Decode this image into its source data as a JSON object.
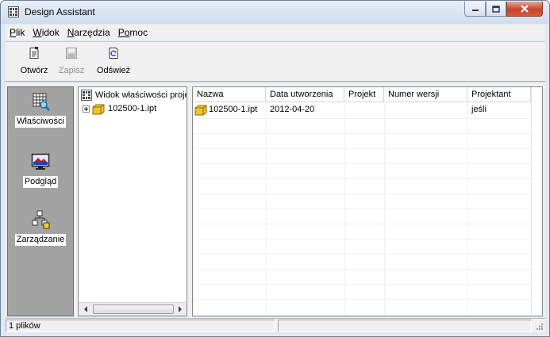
{
  "window": {
    "title": "Design Assistant",
    "app_icon": "design-assistant-icon"
  },
  "menu": [
    {
      "label_u": "P",
      "label_rest": "lik"
    },
    {
      "label_u": "W",
      "label_rest": "idok"
    },
    {
      "label_u": "N",
      "label_rest": "arzędzia"
    },
    {
      "label_u": "Po",
      "label_rest": "moc"
    }
  ],
  "toolbar": {
    "open_label": "Otwórz",
    "save_label": "Zapisz",
    "refresh_label": "Odśwież"
  },
  "leftbar": {
    "properties_label": "Właściwości",
    "preview_label": "Podgląd",
    "manage_label": "Zarządzanie"
  },
  "tree": {
    "root_label": "Widok właściwości proje",
    "node_label": "102500-1.ipt"
  },
  "list": {
    "columns": [
      "Nazwa",
      "Data utworzenia",
      "Projekt",
      "Numer wersji",
      "Projektant"
    ],
    "rows": [
      {
        "name": "102500-1.ipt",
        "created": "2012-04-20",
        "project": "",
        "revision": "",
        "designer": "jeśli"
      }
    ]
  },
  "status": {
    "file_count": "1 plików",
    "secondary": ""
  },
  "colors": {
    "leftbar_bg": "#a3a3a3",
    "close_button": "#c7432b",
    "file_icon": "#f2c230"
  }
}
